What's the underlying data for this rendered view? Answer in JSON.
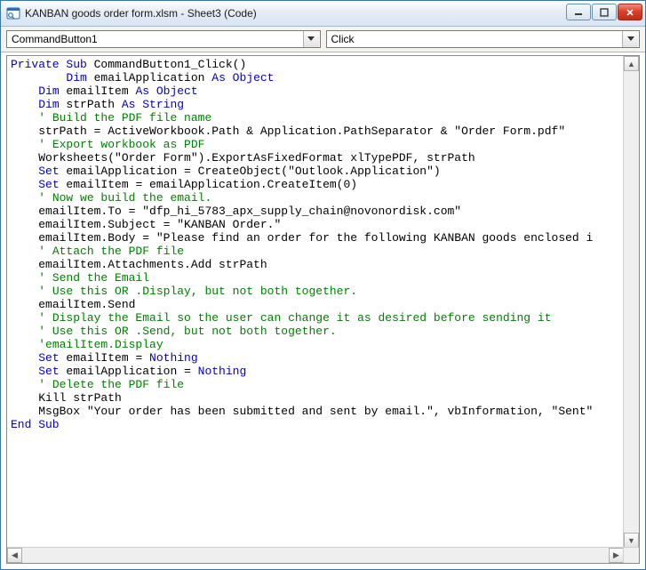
{
  "window": {
    "title": "KANBAN goods order form.xlsm - Sheet3 (Code)"
  },
  "toolbar": {
    "object_combo": "CommandButton1",
    "proc_combo": "Click"
  },
  "code": {
    "lines": [
      {
        "indent": 0,
        "tokens": [
          {
            "t": "Private Sub",
            "c": "kw"
          },
          {
            "t": " CommandButton1_Click()"
          }
        ]
      },
      {
        "indent": 2,
        "tokens": [
          {
            "t": "Dim",
            "c": "kw"
          },
          {
            "t": " emailApplication "
          },
          {
            "t": "As Object",
            "c": "kw"
          }
        ]
      },
      {
        "indent": 1,
        "tokens": [
          {
            "t": "Dim",
            "c": "kw"
          },
          {
            "t": " emailItem "
          },
          {
            "t": "As Object",
            "c": "kw"
          }
        ]
      },
      {
        "indent": 1,
        "tokens": [
          {
            "t": "Dim",
            "c": "kw"
          },
          {
            "t": " strPath "
          },
          {
            "t": "As String",
            "c": "kw"
          }
        ]
      },
      {
        "indent": 1,
        "tokens": [
          {
            "t": "' Build the PDF file name",
            "c": "cm"
          }
        ]
      },
      {
        "indent": 1,
        "tokens": [
          {
            "t": "strPath = ActiveWorkbook.Path & Application.PathSeparator & \"Order Form.pdf\""
          }
        ]
      },
      {
        "indent": 1,
        "tokens": [
          {
            "t": "' Export workbook as PDF",
            "c": "cm"
          }
        ]
      },
      {
        "indent": 1,
        "tokens": [
          {
            "t": "Worksheets(\"Order Form\").ExportAsFixedFormat xlTypePDF, strPath"
          }
        ]
      },
      {
        "indent": 1,
        "tokens": [
          {
            "t": "Set",
            "c": "kw"
          },
          {
            "t": " emailApplication = CreateObject(\"Outlook.Application\")"
          }
        ]
      },
      {
        "indent": 1,
        "tokens": [
          {
            "t": "Set",
            "c": "kw"
          },
          {
            "t": " emailItem = emailApplication.CreateItem(0)"
          }
        ]
      },
      {
        "indent": 1,
        "tokens": [
          {
            "t": "' Now we build the email.",
            "c": "cm"
          }
        ]
      },
      {
        "indent": 1,
        "tokens": [
          {
            "t": "emailItem.To = \"dfp_hi_5783_apx_supply_chain@novonordisk.com\""
          }
        ]
      },
      {
        "indent": 1,
        "tokens": [
          {
            "t": "emailItem.Subject = \"KANBAN Order.\""
          }
        ]
      },
      {
        "indent": 1,
        "tokens": [
          {
            "t": "emailItem.Body = \"Please find an order for the following KANBAN goods enclosed i"
          }
        ]
      },
      {
        "indent": 1,
        "tokens": [
          {
            "t": "' Attach the PDF file",
            "c": "cm"
          }
        ]
      },
      {
        "indent": 1,
        "tokens": [
          {
            "t": "emailItem.Attachments.Add strPath"
          }
        ]
      },
      {
        "indent": 1,
        "tokens": [
          {
            "t": "' Send the Email",
            "c": "cm"
          }
        ]
      },
      {
        "indent": 1,
        "tokens": [
          {
            "t": "' Use this OR .Display, but not both together.",
            "c": "cm"
          }
        ]
      },
      {
        "indent": 1,
        "tokens": [
          {
            "t": "emailItem.Send"
          }
        ]
      },
      {
        "indent": 1,
        "tokens": [
          {
            "t": "' Display the Email so the user can change it as desired before sending it",
            "c": "cm"
          }
        ]
      },
      {
        "indent": 1,
        "tokens": [
          {
            "t": "' Use this OR .Send, but not both together.",
            "c": "cm"
          }
        ]
      },
      {
        "indent": 1,
        "tokens": [
          {
            "t": "'emailItem.Display",
            "c": "cm"
          }
        ]
      },
      {
        "indent": 1,
        "tokens": [
          {
            "t": "Set",
            "c": "kw"
          },
          {
            "t": " emailItem = "
          },
          {
            "t": "Nothing",
            "c": "kw"
          }
        ]
      },
      {
        "indent": 1,
        "tokens": [
          {
            "t": "Set",
            "c": "kw"
          },
          {
            "t": " emailApplication = "
          },
          {
            "t": "Nothing",
            "c": "kw"
          }
        ]
      },
      {
        "indent": 1,
        "tokens": [
          {
            "t": "' Delete the PDF file",
            "c": "cm"
          }
        ]
      },
      {
        "indent": 1,
        "tokens": [
          {
            "t": "Kill strPath"
          }
        ]
      },
      {
        "indent": 1,
        "tokens": [
          {
            "t": "MsgBox \"Your order has been submitted and sent by email.\", vbInformation, \"Sent\""
          }
        ]
      },
      {
        "indent": 0,
        "tokens": [
          {
            "t": "End Sub",
            "c": "kw"
          }
        ]
      }
    ]
  }
}
